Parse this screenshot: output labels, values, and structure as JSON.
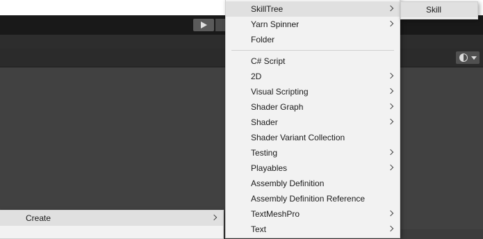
{
  "parent_menu": {
    "items": [
      {
        "label": "Create",
        "submenu": true
      }
    ]
  },
  "create_menu": {
    "group1": [
      {
        "label": "SkillTree",
        "submenu": true,
        "highlighted": true
      },
      {
        "label": "Yarn Spinner",
        "submenu": true
      },
      {
        "label": "Folder",
        "submenu": false
      }
    ],
    "group2": [
      {
        "label": "C# Script",
        "submenu": false
      },
      {
        "label": "2D",
        "submenu": true
      },
      {
        "label": "Visual Scripting",
        "submenu": true
      },
      {
        "label": "Shader Graph",
        "submenu": true
      },
      {
        "label": "Shader",
        "submenu": true
      },
      {
        "label": "Shader Variant Collection",
        "submenu": false
      },
      {
        "label": "Testing",
        "submenu": true
      },
      {
        "label": "Playables",
        "submenu": true
      },
      {
        "label": "Assembly Definition",
        "submenu": false
      },
      {
        "label": "Assembly Definition Reference",
        "submenu": false
      },
      {
        "label": "TextMeshPro",
        "submenu": true
      },
      {
        "label": "Text",
        "submenu": true
      }
    ]
  },
  "skilltree_submenu": {
    "items": [
      {
        "label": "Skill",
        "submenu": false
      }
    ]
  },
  "icons": {
    "play": "play-icon",
    "gizmo": "gizmo-sphere-icon",
    "submenu_arrow": "chevron-right-icon"
  }
}
